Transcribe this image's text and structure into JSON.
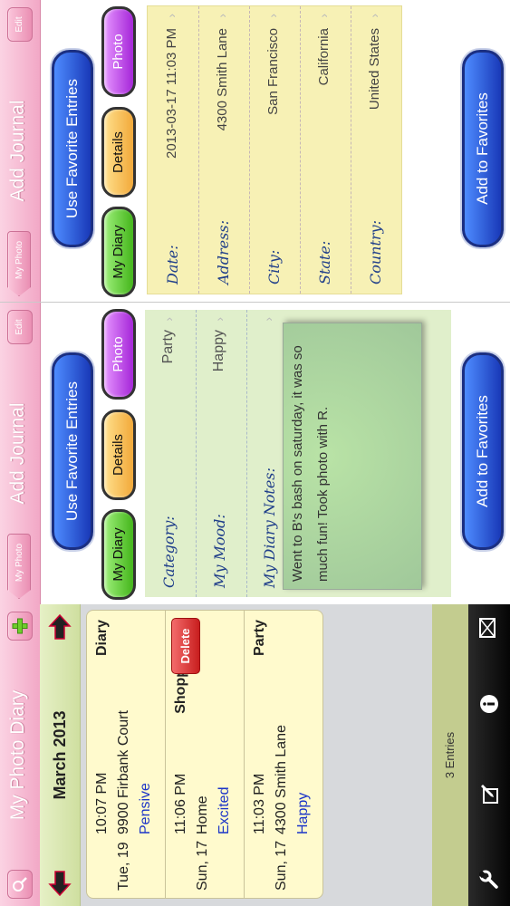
{
  "list_screen": {
    "nav_title": "My Photo Diary",
    "month": "March 2013",
    "entries": [
      {
        "time": "10:07 PM",
        "date": "Tue, 19",
        "place": "9900 Firbank Court",
        "mood": "Pensive",
        "category": "Diary"
      },
      {
        "time": "11:06 PM",
        "date": "Sun, 17",
        "place": "Home",
        "mood": "Excited",
        "category": "Shopping"
      },
      {
        "time": "11:03 PM",
        "date": "Sun, 17",
        "place": "4300 Smith Lane",
        "mood": "Happy",
        "category": "Party"
      }
    ],
    "delete_label": "Delete",
    "entry_count": "3 Entries"
  },
  "notes_screen": {
    "back_label": "My Photo Diary",
    "nav_title": "Add Journal",
    "edit_label": "Edit",
    "fav_top": "Use Favorite Entries",
    "tabs": [
      "My Diary",
      "Details",
      "Photo"
    ],
    "category_label": "Category:",
    "category_value": "Party",
    "mood_label": "My Mood:",
    "mood_value": "Happy",
    "notes_label": "My Diary Notes:",
    "notes_text": "Went to B's bash on saturday, it was so much fun! Took photo with R.",
    "fav_bottom": "Add to Favorites"
  },
  "details_screen": {
    "back_label": "My Photo Diary",
    "nav_title": "Add Journal",
    "edit_label": "Edit",
    "fav_top": "Use Favorite Entries",
    "tabs": [
      "My Diary",
      "Details",
      "Photo"
    ],
    "rows": [
      {
        "label": "Date:",
        "value": "2013-03-17 11:03 PM"
      },
      {
        "label": "Address:",
        "value": "4300 Smith Lane"
      },
      {
        "label": "City:",
        "value": "San Francisco"
      },
      {
        "label": "State:",
        "value": "California"
      },
      {
        "label": "Country:",
        "value": "United States"
      }
    ],
    "fav_bottom": "Add to Favorites"
  },
  "icons": {
    "search": "search-icon",
    "add": "plus-icon",
    "prev_month": "left-arrow-icon",
    "next_month": "right-arrow-icon",
    "settings": "wrench-icon",
    "compose": "compose-icon",
    "info": "info-icon",
    "mail": "mail-icon"
  },
  "colors": {
    "accent_pink": "#f2a8c6",
    "mood_blue": "#1b34c8",
    "button_blue": "#1939b8"
  }
}
